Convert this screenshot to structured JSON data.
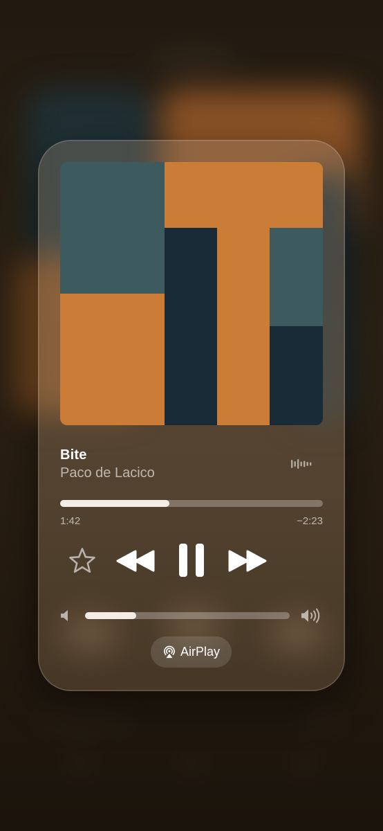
{
  "now_playing": {
    "title": "Bite",
    "artist": "Paco de Lacico",
    "elapsed": "1:42",
    "remaining": "−2:23",
    "progress": 0.415
  },
  "volume": {
    "level": 0.25
  },
  "airplay": {
    "label": "AirPlay"
  },
  "icons": {
    "favorite": "star-icon",
    "rewind": "rewind-icon",
    "pause": "pause-icon",
    "forward": "fast-forward-icon",
    "waveform": "audio-waveform-icon",
    "volume_low": "speaker-low-icon",
    "volume_high": "speaker-high-icon",
    "airplay": "airplay-icon"
  },
  "colors": {
    "art_teal": "#3d5a5f",
    "art_orange": "#cb7d37",
    "art_navy": "#182b36",
    "slider_fill": "#f4ede6"
  }
}
